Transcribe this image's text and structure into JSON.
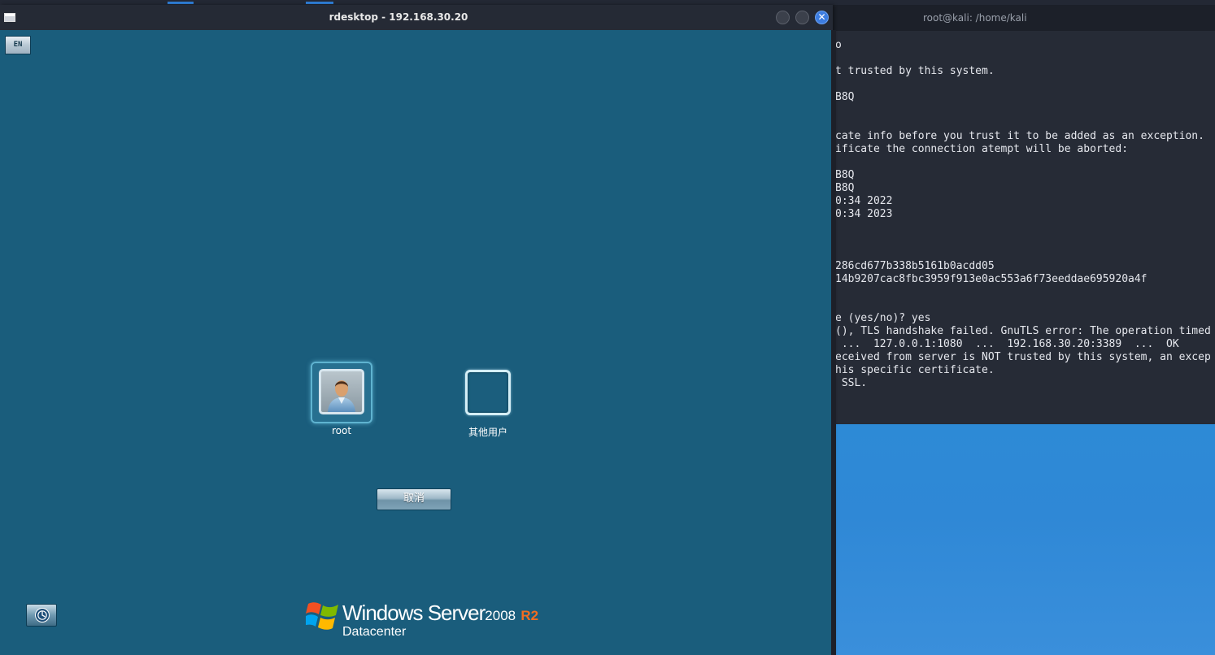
{
  "colors": {
    "rdp_background": "#1a5d7c",
    "terminal_background": "#262b36",
    "desktop_blue": "#2f88d6",
    "close_button": "#3d7de0",
    "r2_accent": "#f26d21"
  },
  "rdp_window": {
    "title": "rdesktop - 192.168.30.20",
    "close_glyph": "✕",
    "language_indicator": "EN",
    "users": [
      {
        "label": "root",
        "icon": "user-avatar-icon"
      },
      {
        "label": "其他用户",
        "icon": "empty-user-frame"
      }
    ],
    "cancel_label": "取消",
    "ease_of_access_icon": "ease-of-access-icon",
    "branding": {
      "product": "Windows Server",
      "version": "2008",
      "release": "R2",
      "edition": "Datacenter"
    }
  },
  "terminal": {
    "title": "root@kali: /home/kali",
    "lines": [
      "o",
      "",
      "t trusted by this system.",
      "",
      "B8Q",
      "",
      "",
      "cate info before you trust it to be added as an exception.",
      "ificate the connection atempt will be aborted:",
      "",
      "B8Q",
      "B8Q",
      "0:34 2022",
      "0:34 2023",
      "",
      "",
      "",
      "286cd677b338b5161b0acdd05",
      "14b9207cac8fbc3959f913e0ac553a6f73eeddae695920a4f",
      "",
      "",
      "e (yes/no)? yes",
      "(), TLS handshake failed. GnuTLS error: The operation timed",
      " ...  127.0.0.1:1080  ...  192.168.30.20:3389  ...  OK",
      "eceived from server is NOT trusted by this system, an excep",
      "his specific certificate.",
      " SSL."
    ]
  }
}
